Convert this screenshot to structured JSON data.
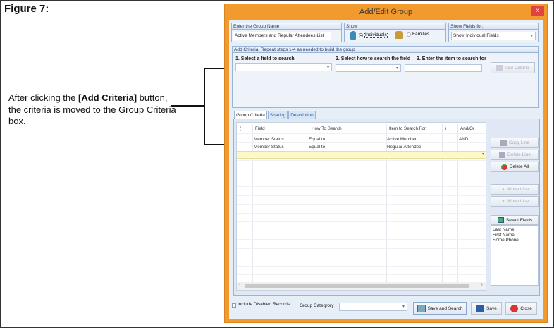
{
  "figure_label": "Figure 7:",
  "note": {
    "before": "After clicking the ",
    "bold": "[Add Criteria]",
    "after": " button, the criteria is moved to the Group Criteria box."
  },
  "dialog": {
    "title": "Add/Edit Group",
    "close_glyph": "×",
    "group_name": {
      "header": "Enter the Group Name",
      "value": "Active Members and Regular Attendees List"
    },
    "show": {
      "header": "Show",
      "options": [
        {
          "label": "Individuals",
          "selected": true,
          "icon": "person-icon"
        },
        {
          "label": "Families",
          "selected": false,
          "icon": "family-icon"
        }
      ]
    },
    "show_fields": {
      "header": "Show Fields for:",
      "value": "Show Individual Fields"
    },
    "add_criteria": {
      "header": "Add Criteria: Repeat steps 1-4 as needed to build the group",
      "step1": "1. Select a field to search",
      "step2": "2. Select how to search the field",
      "step3": "3. Enter the item to search for",
      "step1_value": "",
      "step2_value": "",
      "step3_value": "",
      "button": "Add Criteria"
    },
    "tabs": [
      {
        "label": "Group Criteria",
        "active": true
      },
      {
        "label": "Sharing",
        "active": false
      },
      {
        "label": "Description",
        "active": false
      }
    ],
    "grid": {
      "columns": [
        "(",
        "Field",
        "How To Search",
        "Item to Search For",
        ")",
        "And/Or"
      ],
      "rows": [
        [
          "",
          "Member Status",
          "Equal to",
          "Active Member",
          "",
          "AND"
        ],
        [
          "",
          "Member Status",
          "Equal to",
          "Regular Attendee",
          "",
          ""
        ]
      ]
    },
    "side_buttons": {
      "copy_line": "Copy Line",
      "delete_line": "Delete Line",
      "delete_all": "Delete All",
      "move_up": "Move Line",
      "move_down": "Move Line",
      "select_fields": "Select Fields"
    },
    "selected_fields": [
      "Last Name",
      "First Name",
      "Home Phone"
    ],
    "footer": {
      "include_disabled": "Include Disabled Records",
      "include_disabled_checked": false,
      "group_category_label": "Group Categrory",
      "group_category_value": "",
      "save_and_search": "Save and Search",
      "save": "Save",
      "close": "Close"
    }
  }
}
